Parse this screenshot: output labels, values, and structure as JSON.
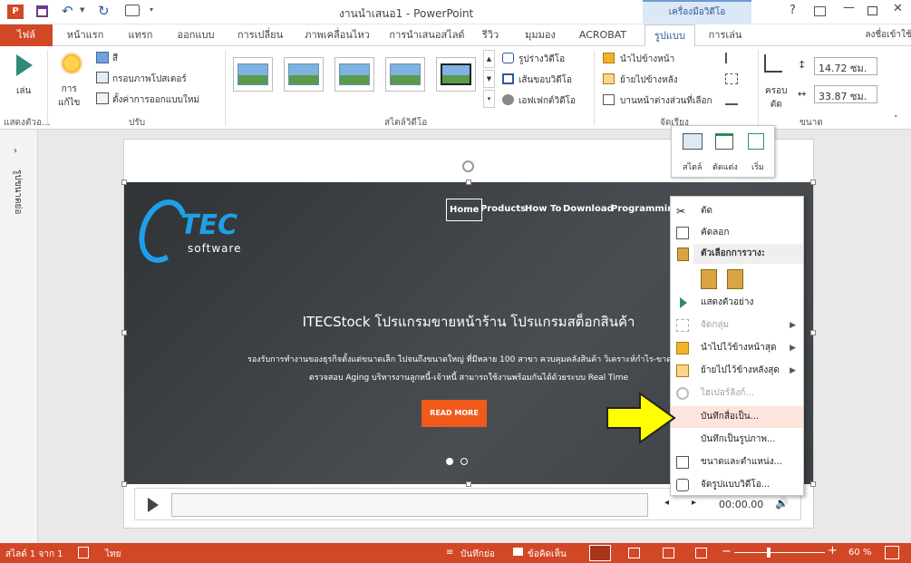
{
  "titlebar": {
    "title": "งานนำเสนอ1 - PowerPoint",
    "context_group": "เครื่องมือวิดีโอ",
    "help": "?",
    "signin": "ลงชื่อเข้าใช้"
  },
  "tabs": {
    "file": "ไฟล์",
    "home": "หน้าแรก",
    "insert": "แทรก",
    "design": "ออกแบบ",
    "transitions": "การเปลี่ยน",
    "animations": "ภาพเคลื่อนไหว",
    "slideshow": "การนำเสนอสไลด์",
    "review": "รีวิว",
    "view": "มุมมอง",
    "acrobat": "ACROBAT",
    "format": "รูปแบบ",
    "playback": "การเล่น"
  },
  "ribbon": {
    "play": "เล่น",
    "corrections": "การ\nแก้ไข",
    "color": "สี",
    "poster_frame": "กรอบภาพโปสเตอร์",
    "reset_design": "ตั้งค่าการออกแบบใหม่",
    "video_shape": "รูปร่างวิดีโอ",
    "video_border": "เส้นขอบวิดีโอ",
    "video_effects": "เอฟเฟกต์วิดีโอ",
    "bring_forward": "นำไปข้างหน้า",
    "send_backward": "ย้ายไปข้างหลัง",
    "selection_pane": "บานหน้าต่างส่วนที่เลือก",
    "crop": "ครอบ\nตัด",
    "height": "14.72 ซม.",
    "width": "33.87 ซม.",
    "group_preview": "แสดงตัวอ...",
    "group_adjust": "ปรับ",
    "group_styles": "สไตล์วิดีโอ",
    "group_arrange": "จัดเรียง",
    "group_size": "ขนาด"
  },
  "leftpane": {
    "label": "รูปขนาดย่อ"
  },
  "video": {
    "logo_main": "TEC",
    "logo_sub": "software",
    "nav": [
      "Home",
      "Products",
      "How To",
      "Download",
      "Programming"
    ],
    "headline": "ITECStock โปรแกรมขายหน้าร้าน โปรแกรมสต็อกสินค้า",
    "line1": "รองรับการทำงานของธุรกิจตั้งแต่ขนาดเล็ก ไปจนถึงขนาดใหญ่ ที่มีหลาย 100 สาขา ควบคุมคลังสินค้า วิเคราะห์กำไร-ขาดทุน",
    "line2": "ตรวจสอบ Aging บริหารงานลูกหนี้-เจ้าหนี้ สามารถใช้งานพร้อมกันได้ด้วยระบบ Real Time",
    "cta": "READ MORE"
  },
  "player": {
    "time": "00:00.00"
  },
  "minitoolbar": {
    "style": "สไตล์",
    "trim": "ตัดแต่ง",
    "start": "เริ่ม"
  },
  "contextmenu": {
    "cut": "ตัด",
    "copy": "คัดลอก",
    "paste_options": "ตัวเลือกการวาง:",
    "preview": "แสดงตัวอย่าง",
    "group": "จัดกลุ่ม",
    "bring_front": "นำไปไว้ข้างหน้าสุด",
    "send_back": "ย้ายไปไว้ข้างหลังสุด",
    "hyperlink": "ไฮเปอร์ลิงก์...",
    "save_as": "บันทึกสื่อเป็น...",
    "save_picture": "บันทึกเป็นรูปภาพ...",
    "size_position": "ขนาดและตำแหน่ง...",
    "format_video": "จัดรูปแบบวิดีโอ..."
  },
  "statusbar": {
    "slide": "สไลด์ 1 จาก 1",
    "lang": "ไทย",
    "notes": "บันทึกย่อ",
    "comments": "ข้อคิดเห็น",
    "zoom": "60 %"
  },
  "colors": {
    "accent": "#d24726",
    "arrow": "#ffff00"
  }
}
